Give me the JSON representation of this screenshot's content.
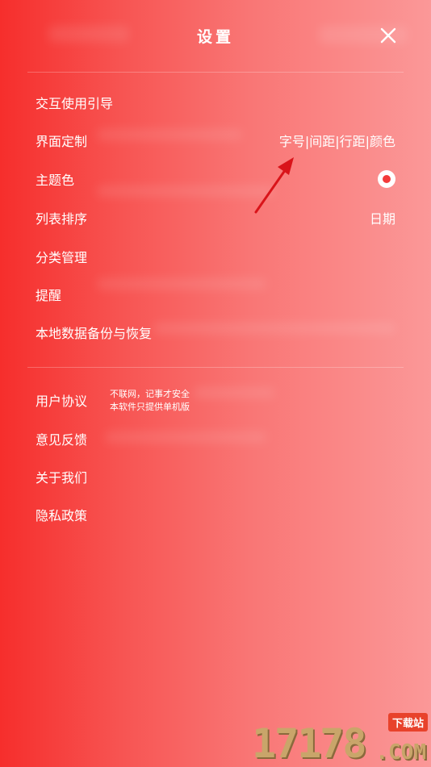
{
  "header": {
    "title": "设置"
  },
  "menu_group1": [
    {
      "label": "交互使用引导",
      "value": ""
    },
    {
      "label": "界面定制",
      "value": "字号|间距|行距|颜色"
    },
    {
      "label": "主题色",
      "value": ""
    },
    {
      "label": "列表排序",
      "value": "日期"
    },
    {
      "label": "分类管理",
      "value": ""
    },
    {
      "label": "提醒",
      "value": ""
    },
    {
      "label": "本地数据备份与恢复",
      "value": ""
    }
  ],
  "menu_group2": [
    {
      "label": "用户协议"
    },
    {
      "label": "意见反馈"
    },
    {
      "label": "关于我们"
    },
    {
      "label": "隐私政策"
    }
  ],
  "notice": {
    "line1": "不联网，记事才安全",
    "line2": "本软件只提供单机版"
  },
  "watermark": {
    "digits": "17178",
    "badge": "下载站",
    "com": ".COM"
  },
  "colors": {
    "background_left": "#f62e2c",
    "background_right": "#fb9898",
    "theme_dot": "#f33a3a",
    "arrow": "#d9141a"
  },
  "icons": {
    "close": "close-icon",
    "theme_color": "radio-selected-icon",
    "annotation": "arrow-annotation-icon"
  }
}
